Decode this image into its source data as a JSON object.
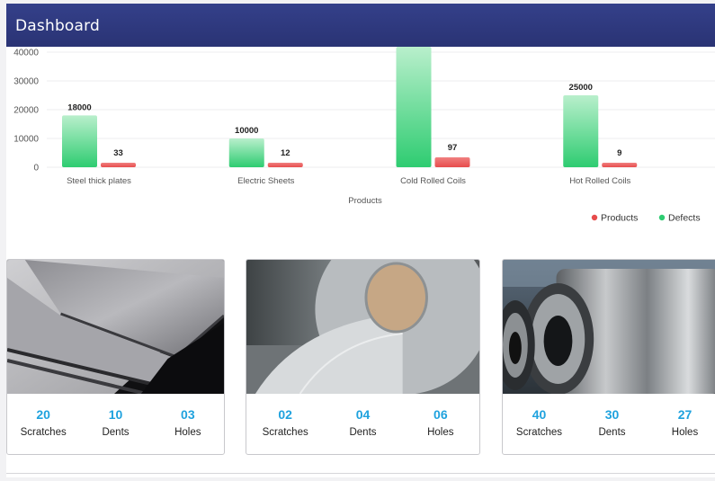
{
  "header": {
    "title": "Dashboard"
  },
  "colors": {
    "header_bg": "#2e387c",
    "defects_green": "#2ecc71",
    "products_red": "#e74c4c",
    "stat_blue": "#1fa2de"
  },
  "chart_data": {
    "type": "bar",
    "xlabel": "Products",
    "ylabel": "",
    "categories": [
      "Steel thick plates",
      "Electric Sheets",
      "Cold Rolled Coils",
      "Hot Rolled Coils"
    ],
    "yticks": [
      0,
      10000,
      20000,
      30000,
      40000
    ],
    "ylim": [
      0,
      40000
    ],
    "grid": true,
    "legend_position": "bottom-right",
    "series": [
      {
        "name": "Defects",
        "color": "#2ecc71",
        "values": [
          18000,
          10000,
          45000,
          25000
        ],
        "labels": [
          "18000",
          "10000",
          "",
          "25000"
        ]
      },
      {
        "name": "Products",
        "color": "#e74c4c",
        "values": [
          33,
          12,
          97,
          9
        ],
        "labels": [
          "33",
          "12",
          "97",
          "9"
        ]
      }
    ],
    "legend": [
      {
        "name": "Products",
        "color": "#e74c4c"
      },
      {
        "name": "Defects",
        "color": "#2ecc71"
      }
    ]
  },
  "cards": [
    {
      "image": "steel-plates-photo",
      "stats": [
        {
          "value": "20",
          "label": "Scratches"
        },
        {
          "value": "10",
          "label": "Dents"
        },
        {
          "value": "03",
          "label": "Holes"
        }
      ]
    },
    {
      "image": "steel-coil-photo",
      "stats": [
        {
          "value": "02",
          "label": "Scratches"
        },
        {
          "value": "04",
          "label": "Dents"
        },
        {
          "value": "06",
          "label": "Holes"
        }
      ]
    },
    {
      "image": "hot-rolled-coils-photo",
      "stats": [
        {
          "value": "40",
          "label": "Scratches"
        },
        {
          "value": "30",
          "label": "Dents"
        },
        {
          "value": "27",
          "label": "Holes"
        }
      ]
    }
  ]
}
